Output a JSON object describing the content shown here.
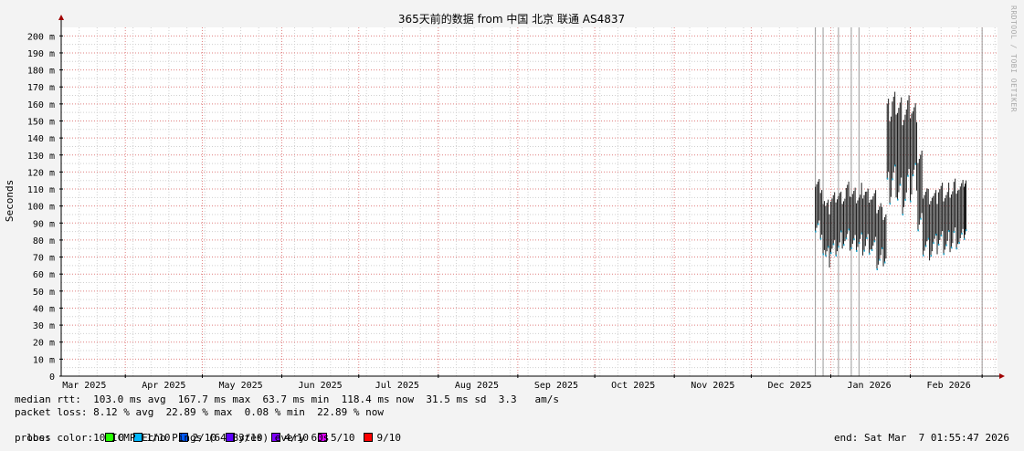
{
  "chart_data": {
    "type": "line",
    "title": "365天前的数据 from 中国 北京 联通 AS4837",
    "ylabel": "Seconds",
    "xlabel": "",
    "ylim": [
      0,
      205
    ],
    "grid": true,
    "yticks": [
      {
        "value": 0,
        "label": "0"
      },
      {
        "value": 10,
        "label": "10 m"
      },
      {
        "value": 20,
        "label": "20 m"
      },
      {
        "value": 30,
        "label": "30 m"
      },
      {
        "value": 40,
        "label": "40 m"
      },
      {
        "value": 50,
        "label": "50 m"
      },
      {
        "value": 60,
        "label": "60 m"
      },
      {
        "value": 70,
        "label": "70 m"
      },
      {
        "value": 80,
        "label": "80 m"
      },
      {
        "value": 90,
        "label": "90 m"
      },
      {
        "value": 100,
        "label": "100 m"
      },
      {
        "value": 110,
        "label": "110 m"
      },
      {
        "value": 120,
        "label": "120 m"
      },
      {
        "value": 130,
        "label": "130 m"
      },
      {
        "value": 140,
        "label": "140 m"
      },
      {
        "value": 150,
        "label": "150 m"
      },
      {
        "value": 160,
        "label": "160 m"
      },
      {
        "value": 170,
        "label": "170 m"
      },
      {
        "value": 180,
        "label": "180 m"
      },
      {
        "value": 190,
        "label": "190 m"
      },
      {
        "value": 200,
        "label": "200 m"
      }
    ],
    "x_range": [
      "2025-03-07",
      "2026-03-07"
    ],
    "month_starts": [
      "2025-04-01",
      "2025-05-01",
      "2025-06-01",
      "2025-07-01",
      "2025-08-01",
      "2025-09-01",
      "2025-10-01",
      "2025-11-01",
      "2025-12-01",
      "2026-01-01",
      "2026-02-01",
      "2026-03-01"
    ],
    "xticks": [
      {
        "date": "2025-03-16",
        "label": "Mar 2025"
      },
      {
        "date": "2025-04-16",
        "label": "Apr 2025"
      },
      {
        "date": "2025-05-16",
        "label": "May 2025"
      },
      {
        "date": "2025-06-16",
        "label": "Jun 2025"
      },
      {
        "date": "2025-07-16",
        "label": "Jul 2025"
      },
      {
        "date": "2025-08-16",
        "label": "Aug 2025"
      },
      {
        "date": "2025-09-16",
        "label": "Sep 2025"
      },
      {
        "date": "2025-10-16",
        "label": "Oct 2025"
      },
      {
        "date": "2025-11-16",
        "label": "Nov 2025"
      },
      {
        "date": "2025-12-16",
        "label": "Dec 2025"
      },
      {
        "date": "2026-01-16",
        "label": "Jan 2026"
      },
      {
        "date": "2026-02-16",
        "label": "Feb 2026"
      }
    ],
    "series": [
      {
        "color": "#1a1a1a",
        "points": [
          {
            "x": "2025-12-26",
            "min": 85,
            "max": 120
          },
          {
            "x": "2025-12-28",
            "min": 70,
            "max": 110
          },
          {
            "x": "2025-12-30",
            "min": 63,
            "max": 105
          },
          {
            "x": "2026-01-01",
            "min": 68,
            "max": 110
          },
          {
            "x": "2026-01-03",
            "min": 70,
            "max": 112
          },
          {
            "x": "2026-01-05",
            "min": 75,
            "max": 110
          },
          {
            "x": "2026-01-07",
            "min": 72,
            "max": 115
          },
          {
            "x": "2026-01-09",
            "min": 70,
            "max": 112
          },
          {
            "x": "2026-01-11",
            "min": 72,
            "max": 110
          },
          {
            "x": "2026-01-13",
            "min": 70,
            "max": 115
          },
          {
            "x": "2026-01-15",
            "min": 72,
            "max": 112
          },
          {
            "x": "2026-01-17",
            "min": 68,
            "max": 110
          },
          {
            "x": "2026-01-19",
            "min": 60,
            "max": 105
          },
          {
            "x": "2026-01-21",
            "min": 63,
            "max": 100
          },
          {
            "x": "2026-01-23",
            "min": 100,
            "max": 165
          },
          {
            "x": "2026-01-25",
            "min": 105,
            "max": 170
          },
          {
            "x": "2026-01-27",
            "min": 98,
            "max": 168
          },
          {
            "x": "2026-01-29",
            "min": 95,
            "max": 165
          },
          {
            "x": "2026-01-31",
            "min": 100,
            "max": 166
          },
          {
            "x": "2026-02-02",
            "min": 108,
            "max": 162
          },
          {
            "x": "2026-02-04",
            "min": 80,
            "max": 135
          },
          {
            "x": "2026-02-06",
            "min": 70,
            "max": 115
          },
          {
            "x": "2026-02-08",
            "min": 68,
            "max": 112
          },
          {
            "x": "2026-02-10",
            "min": 70,
            "max": 110
          },
          {
            "x": "2026-02-12",
            "min": 72,
            "max": 115
          },
          {
            "x": "2026-02-14",
            "min": 70,
            "max": 112
          },
          {
            "x": "2026-02-16",
            "min": 72,
            "max": 115
          },
          {
            "x": "2026-02-18",
            "min": 75,
            "max": 118
          },
          {
            "x": "2026-02-20",
            "min": 72,
            "max": 116
          },
          {
            "x": "2026-02-22",
            "min": 78,
            "max": 120
          }
        ]
      }
    ],
    "loss_markers": [
      "2025-12-26",
      "2025-12-29",
      "2026-01-04",
      "2026-01-09",
      "2026-01-12",
      "2026-03-01"
    ]
  },
  "stats": {
    "median_rtt": "median rtt:  103.0 ms avg  167.7 ms max  63.7 ms min  118.4 ms now  31.5 ms sd  3.3   am/s",
    "packet_loss": "packet loss: 8.12 % avg  22.89 % max  0.08 % min  22.89 % now",
    "loss_color_label": "loss color:",
    "loss_colors": [
      {
        "label": "0",
        "color": "#26ff00"
      },
      {
        "label": "1/10",
        "color": "#00b8ff"
      },
      {
        "label": "2/10",
        "color": "#0059ff"
      },
      {
        "label": "3/10",
        "color": "#5e00ff"
      },
      {
        "label": "4/10",
        "color": "#7e00ff"
      },
      {
        "label": "5/10",
        "color": "#dd00ff"
      },
      {
        "label": "9/10",
        "color": "#ff0000"
      }
    ],
    "probe": "probe:       10 ICMP Echo Pings (64 Bytes) every 60s",
    "end": "end: Sat Mar  7 01:55:47 2026"
  },
  "watermark": "RRDTOOL / TOBI OETIKER",
  "colors": {
    "axis": "#000000",
    "grid_major": "#e08080",
    "grid_minor": "#d0d0d0",
    "plot_bg": "#ffffff",
    "arrow": "#a00000"
  }
}
